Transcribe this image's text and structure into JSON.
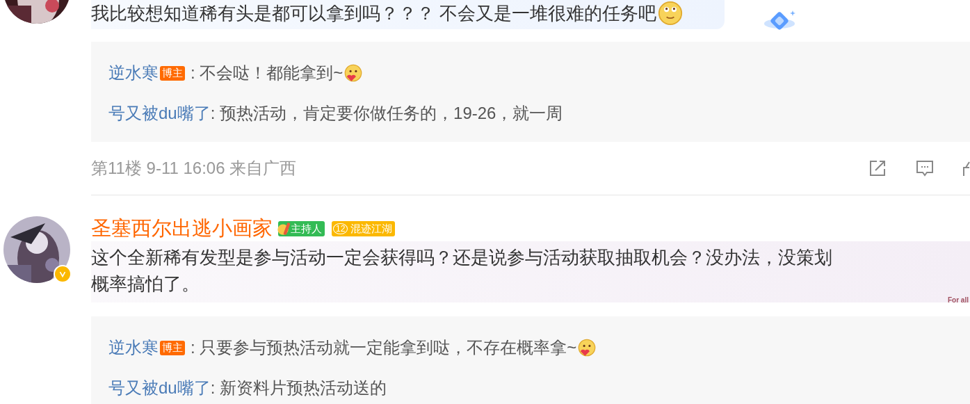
{
  "comments": [
    {
      "kind": "blue",
      "lines": [
        "我比较想知道稀有头是都可以拿到吗？？？ 不会又是一堆很难的任务吧"
      ],
      "emoji": true,
      "replies": [
        {
          "author": "逆水寒",
          "badge": "博主",
          "text": ": 不会哒！都能拿到~",
          "emoji": true
        },
        {
          "author": "号又被du嘴了",
          "text": ": 预热活动，肯定要你做任务的，19-26，就一周",
          "emoji": false
        }
      ],
      "meta": "第11楼 9-11 16:06 来自广西"
    },
    {
      "author": "圣塞西尔出逃小画家",
      "verified": true,
      "badges": [
        {
          "kind": "host",
          "label": "主持人"
        },
        {
          "kind": "rank",
          "level": "12",
          "label": "混迹江湖"
        }
      ],
      "kind": "pink",
      "lines": [
        "这个全新稀有发型是参与活动一定会获得吗？还是说参与活动获取抽取机会？没办法，没策划",
        "概率搞怕了。"
      ],
      "emoji": false,
      "bubble_tag": "For all",
      "replies": [
        {
          "author": "逆水寒",
          "badge": "博主",
          "text": ": 只要参与预热活动就一定能拿到哒，不存在概率拿~",
          "emoji": true
        },
        {
          "author": "号又被du嘴了",
          "text": ": 新资料片预热活动送的",
          "emoji": false
        }
      ]
    }
  ]
}
